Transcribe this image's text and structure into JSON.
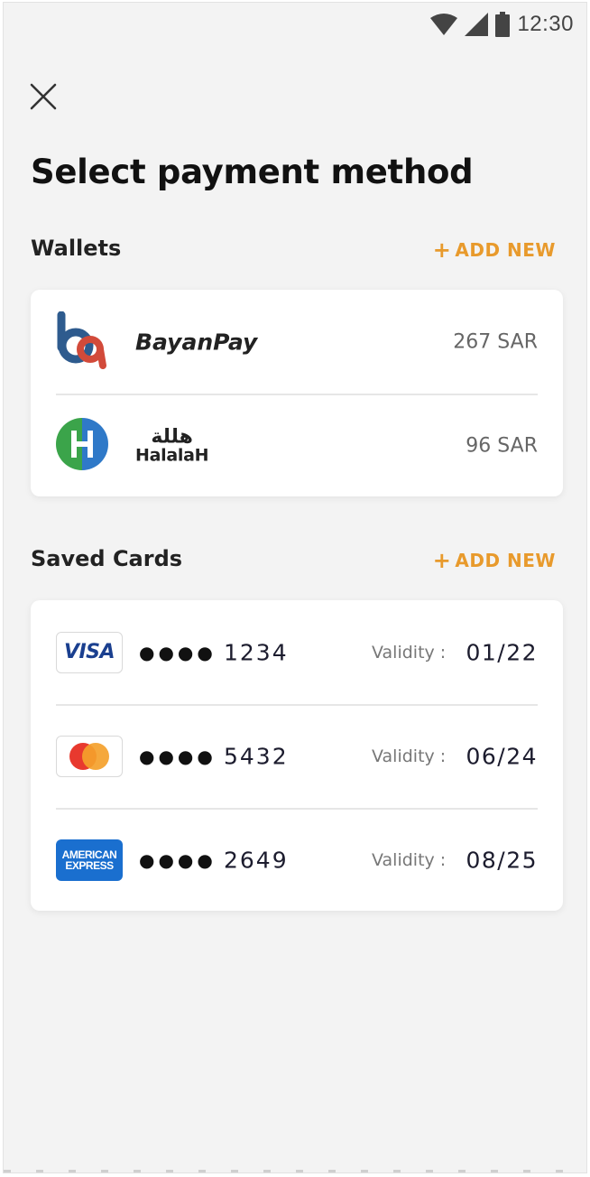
{
  "status_bar": {
    "time": "12:30"
  },
  "header": {
    "title": "Select payment method"
  },
  "wallets": {
    "title": "Wallets",
    "add_new": "ADD NEW",
    "items": [
      {
        "name": "BayanPay",
        "amount": "267 SAR",
        "icon": "bayanpay-logo"
      },
      {
        "name": "HalalaH",
        "name_arabic": "هللة",
        "amount": "96 SAR",
        "icon": "halalah-logo"
      }
    ]
  },
  "saved_cards": {
    "title": "Saved Cards",
    "add_new": "ADD NEW",
    "items": [
      {
        "brand": "VISA",
        "masked": "●●●●",
        "last4": "1234",
        "validity_label": "Validity :",
        "validity": "01/22"
      },
      {
        "brand": "mastercard",
        "masked": "●●●●",
        "last4": "5432",
        "validity_label": "Validity :",
        "validity": "06/24"
      },
      {
        "brand_line1": "AMERICAN",
        "brand_line2": "EXPRESS",
        "masked": "●●●●",
        "last4": "2649",
        "validity_label": "Validity :",
        "validity": "08/25"
      }
    ]
  },
  "colors": {
    "accent": "#e89a2c",
    "background": "#f3f3f3",
    "card": "#ffffff"
  }
}
